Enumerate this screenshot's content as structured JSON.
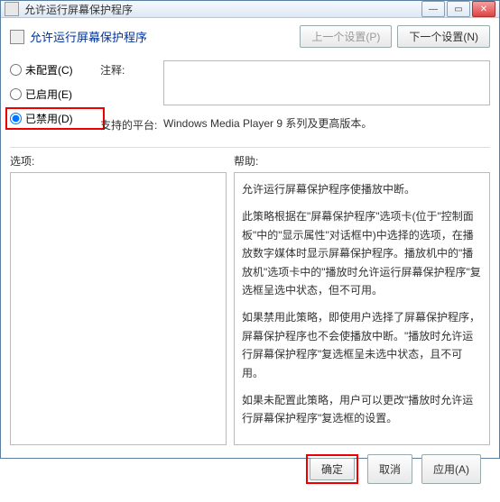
{
  "window": {
    "title": "允许运行屏幕保护程序"
  },
  "nav": {
    "prev": "上一个设置(P)",
    "next": "下一个设置(N)"
  },
  "page": {
    "title": "允许运行屏幕保护程序"
  },
  "radios": {
    "not_configured": "未配置(C)",
    "enabled": "已启用(E)",
    "disabled": "已禁用(D)"
  },
  "fields": {
    "comment_label": "注释:",
    "platform_label": "支持的平台:",
    "platform_value": "Windows Media Player 9 系列及更高版本。"
  },
  "sections": {
    "options": "选项:",
    "help": "帮助:"
  },
  "help": {
    "p1": "允许运行屏幕保护程序使播放中断。",
    "p2": "此策略根据在\"屏幕保护程序\"选项卡(位于\"控制面板\"中的\"显示属性\"对话框中)中选择的选项，在播放数字媒体时显示屏幕保护程序。播放机中的\"播放机\"选项卡中的\"播放时允许运行屏幕保护程序\"复选框呈选中状态，但不可用。",
    "p3": "如果禁用此策略，即使用户选择了屏幕保护程序，屏幕保护程序也不会使播放中断。\"播放时允许运行屏幕保护程序\"复选框呈未选中状态，且不可用。",
    "p4": "如果未配置此策略，用户可以更改\"播放时允许运行屏幕保护程序\"复选框的设置。"
  },
  "buttons": {
    "ok": "确定",
    "cancel": "取消",
    "apply": "应用(A)"
  }
}
